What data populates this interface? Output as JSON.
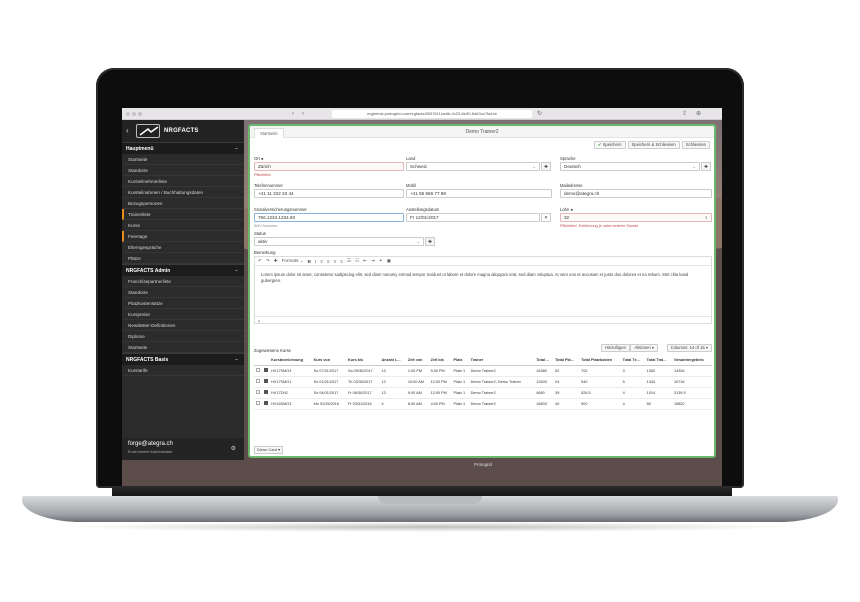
{
  "browser": {
    "url": "nrgbemis.protogrid.com/nrgfacts/853761f-bedb-4c23-8e30-6d63cc7fa44e",
    "lock_icon": "lock-icon",
    "share_icon": "share-icon"
  },
  "sidebar": {
    "brand": "NRGFACTS",
    "sections": [
      {
        "title": "Hauptmenü",
        "toggle": "−",
        "items": [
          {
            "label": "Startseite",
            "accent": false
          },
          {
            "label": "Standorte",
            "accent": false
          },
          {
            "label": "Kursteilnehmerliste",
            "accent": false
          },
          {
            "label": "Kursteilnahmen / Buchhaltungsdaten",
            "accent": false
          },
          {
            "label": "Bezugspersonen",
            "accent": false
          },
          {
            "label": "Trainerliste",
            "accent": true
          },
          {
            "label": "Kurse",
            "accent": false
          },
          {
            "label": "Feiertage",
            "accent": true
          },
          {
            "label": "Elterngespräche",
            "accent": false
          },
          {
            "label": "Plätze",
            "accent": false
          }
        ]
      },
      {
        "title": "NRGFACTS Admin",
        "toggle": "−",
        "items": [
          {
            "label": "Franchisepartnerliste",
            "accent": false
          },
          {
            "label": "Standorte",
            "accent": false
          },
          {
            "label": "Platzkostensätze",
            "accent": false
          },
          {
            "label": "Kurspreise",
            "accent": false
          },
          {
            "label": "Newsletter-Definitionen",
            "accent": false
          },
          {
            "label": "Diplome",
            "accent": false
          },
          {
            "label": "Startseite",
            "accent": false
          }
        ]
      },
      {
        "title": "NRGFACTS Basis",
        "toggle": "−",
        "items": [
          {
            "label": "Kurstarife",
            "accent": false
          }
        ]
      }
    ],
    "user": {
      "name": "forge@ategra.ch",
      "role": "Environment Administrator"
    }
  },
  "card": {
    "tab": "Startseite",
    "title": "Demo Trainer2",
    "actions": {
      "save": "Speichern",
      "save_close": "Speichern & Schliessen",
      "close": "Schliessen"
    },
    "fields": {
      "ort_label": "Ort ●",
      "ort_value": "Zürich",
      "ort_help": "Pflichtfeld",
      "land_label": "Land",
      "land_value": "Schweiz",
      "sprache_label": "Sprache",
      "sprache_value": "Deutsch",
      "telefon_label": "Telefonnummer",
      "telefon_value": "+41 11 222 33 44",
      "mobil_label": "Mobil",
      "mobil_value": "+41 55 666 77 88",
      "mail_label": "Mailadresse",
      "mail_value": "demo@ategra.ch",
      "ahv_label": "Sozialversicherungsnummer",
      "ahv_value": "756.1234.1234.60",
      "ahv_help": "AHV-Nummer",
      "anstellung_label": "Anstellungsdatum",
      "anstellung_value": "Fr 12/01/2017",
      "lohn_label": "Lohn ●",
      "lohn_value": "32",
      "lohn_help": "Pflichtfeld. Entlöhnung je unterrichteter Stunde",
      "status_label": "Status",
      "status_value": "aktiv",
      "bemerkung_label": "Bemerkung"
    },
    "editor": {
      "formats_label": "Formats",
      "text": "Lorem ipsum dolor sit amet, consetetur sadipscing elitr, sed diam nonumy eirmod tempor invidunt ut labore et dolore magna aliquyam erat, sed diam voluptua. At vero eos et accusam et justo duo dolores et ea rebum. Stet clita kasd gubergren.",
      "footer": "p"
    },
    "courses": {
      "title": "Zugewiesene Kurse",
      "add": "Hinzufügen",
      "actions": "Aktionen ▾",
      "columns": "Columns: 14 of 15 ▾",
      "headers": [
        "",
        "",
        "Kursbezeichnung",
        "Kurs von",
        "Kurs bis",
        "Anzahl L...",
        "Zeit von",
        "Zeit bis",
        "Platz",
        "Trainer",
        "Total ...",
        "Total Pla...",
        "Total Platzkosten",
        "Total Te...",
        "Total Trai...",
        "Gesamtergebnis"
      ],
      "rows": [
        [
          "HV17SMO3",
          "So 07/01/2017",
          "Sa 09/30/2017",
          "13",
          "1:00 PM",
          "5:00 PM",
          "Platz 1",
          "Demo Trainer2",
          "16380",
          "52",
          "702",
          "3",
          "1352",
          "14326"
        ],
        [
          "HV17SMO1",
          "So 01/01/2017",
          "Th 03/30/2017",
          "12",
          "10:00 AM",
          "12:00 PM",
          "Platz 1",
          "Demo Trainer2, Demo Trainer",
          "12600",
          "24",
          "540",
          "5",
          "1344",
          "10716"
        ],
        [
          "HV17ZH2",
          "So 04/01/2017",
          "Fr 06/30/2017",
          "13",
          "9:00 AM",
          "12:00 PM",
          "Platz 1",
          "Demo Trainer2",
          "4680",
          "39",
          "526.5",
          "4",
          "1014",
          "3139.5"
        ],
        [
          "HV16SMO3",
          "Mo 01/25/2016",
          "Fr 03/31/2016",
          "4",
          "8:00 AM",
          "4:00 PM",
          "Platz 1",
          "Demo Trainer2",
          "16800",
          "40",
          "900",
          "4",
          "80",
          "15820"
        ]
      ],
      "footer_label": "Diese Card ▾"
    },
    "statusbar": "Protogrid"
  }
}
